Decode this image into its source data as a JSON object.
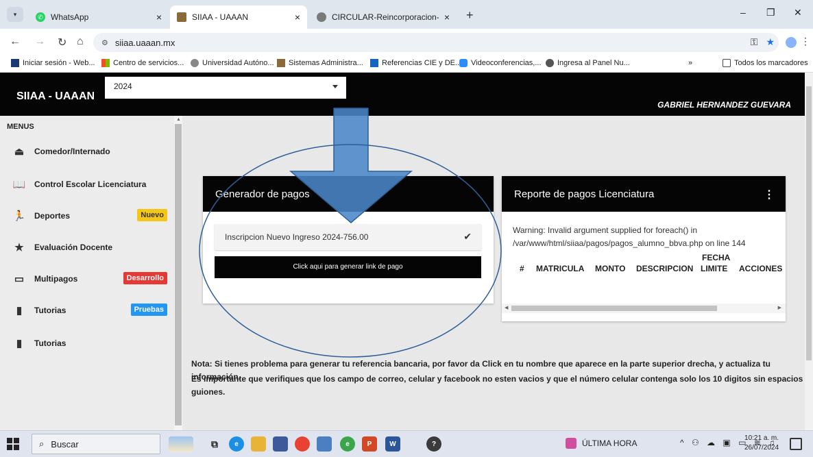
{
  "browser": {
    "tabs": [
      {
        "label": "WhatsApp",
        "active": false
      },
      {
        "label": "SIIAA - UAAAN",
        "active": true
      },
      {
        "label": "CIRCULAR-Reincorporacion-ag",
        "active": false
      }
    ],
    "url": "siiaa.uaaan.mx",
    "bookmarks": [
      "Iniciar sesión - Web...",
      "Centro de servicios...",
      "Universidad Autóno...",
      "Sistemas Administra...",
      "Referencias CIE y DE...",
      "Videoconferencias,...",
      "Ingresa al Panel Nu..."
    ],
    "bookmarks_overflow": "»",
    "all_bookmarks": "Todos los marcadores"
  },
  "header": {
    "brand": "SIIAA - UAAAN",
    "year": "2024",
    "user": "GABRIEL HERNANDEZ GUEVARA"
  },
  "sidebar": {
    "heading": "MENUS",
    "items": [
      {
        "label": "Comedor/Internado",
        "icon": "eject-icon",
        "badge": "",
        "badge_color": ""
      },
      {
        "label": "Control Escolar Licenciatura",
        "icon": "book-open-icon",
        "badge": "",
        "badge_color": ""
      },
      {
        "label": "Deportes",
        "icon": "running-icon",
        "badge": "Nuevo",
        "badge_color": "#f5c518"
      },
      {
        "label": "Evaluación Docente",
        "icon": "star-icon",
        "badge": "",
        "badge_color": ""
      },
      {
        "label": "Multipagos",
        "icon": "card-icon",
        "badge": "Desarrollo",
        "badge_color": "#e53935"
      },
      {
        "label": "Tutorias",
        "icon": "book-icon",
        "badge": "Pruebas",
        "badge_color": "#2196f3"
      },
      {
        "label": "Tutorias",
        "icon": "book-icon",
        "badge": "",
        "badge_color": ""
      }
    ]
  },
  "payments_card": {
    "title": "Generador de pagos",
    "item": "Inscripcion Nuevo Ingreso 2024-756.00",
    "button": "Click aqui para generar link de pago"
  },
  "report_card": {
    "title": "Reporte de pagos Licenciatura",
    "warning_line1": "Warning: Invalid argument supplied for foreach() in",
    "warning_line2": "/var/www/html/siiaa/pagos/pagos_alumno_bbva.php on line 144",
    "columns": [
      "#",
      "MATRICULA",
      "MONTO",
      "DESCRIPCION",
      "FECHA",
      "LIMITE",
      "ACCIONES"
    ]
  },
  "notes": {
    "note1": "Nota: Si tienes problema para generar tu referencia bancaria, por favor da Click en tu nombre que aparece en la parte superior drecha, y actualiza tu información.",
    "note2a": "Es importante que verifiques que los campo de correo, celular y facebook no esten vacios y que el número celular contenga solo los 10 digitos sin espacios ni",
    "note2b": "guiones."
  },
  "taskbar": {
    "search": "Buscar",
    "news": "ÚLTIMA HORA",
    "time": "10:21 a. m.",
    "date": "26/07/2024"
  },
  "colors": {
    "header_bg": "#050505",
    "annotation_blue": "#4a86c8",
    "badge_new": "#f5c518",
    "badge_dev": "#e53935",
    "badge_test": "#2196f3"
  }
}
